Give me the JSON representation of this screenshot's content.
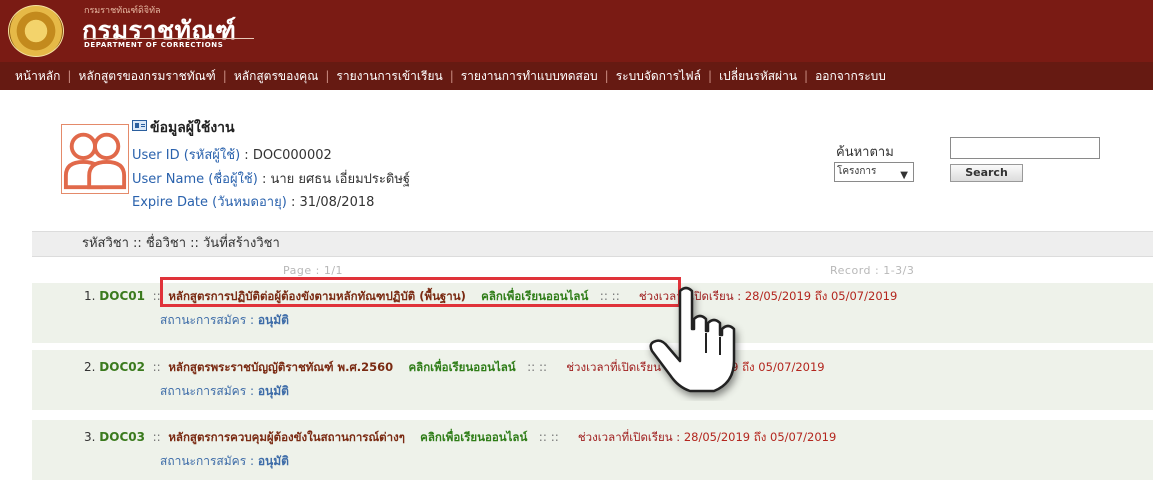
{
  "header": {
    "org_subtitle": "กรมราชทัณฑ์ดิจิทัล",
    "org_title": "กรมราชทัณฑ์",
    "org_english": "DEPARTMENT OF CORRECTIONS"
  },
  "nav": {
    "items": [
      "หน้าหลัก",
      "หลักสูตรของกรมราชทัณฑ์",
      "หลักสูตรของคุณ",
      "รายงานการเข้าเรียน",
      "รายงานการทำแบบทดสอบ",
      "ระบบจัดการไฟล์",
      "เปลี่ยนรหัสผ่าน",
      "ออกจากระบบ"
    ]
  },
  "user": {
    "title": "ข้อมูลผู้ใช้งาน",
    "id_label": "User ID (รหัสผู้ใช้)",
    "id_value": " : DOC000002",
    "name_label": "User Name (ชื่อผู้ใช้)",
    "name_value": " : นาย ยศธน  เอี่ยมประดิษฐ์",
    "expire_label": "Expire Date (วันหมดอายุ)",
    "expire_value": " : 31/08/2018"
  },
  "search": {
    "label": "ค้นหาตาม",
    "input_value": "",
    "select_value": "โครงการ",
    "button": "Search"
  },
  "course_list": {
    "header": "รหัสวิชา :: ชื่อวิชา :: วันที่สร้างวิชา",
    "page": "Page : 1/1",
    "record": "Record : 1-3/3",
    "items": [
      {
        "num": "1.",
        "code": "DOC01",
        "name": "หลักสูตรการปฏิบัติต่อผู้ต้องขังตามหลักทัณฑปฏิบัติ (พื้นฐาน)",
        "learn": "คลิกเพื่อเรียนออนไลน์",
        "period_label": "ช่วงเวลาที่เปิดเรียน :",
        "period": "28/05/2019 ถึง 05/07/2019",
        "status_label": "สถานะการสมัคร :",
        "status": "อนุมัติ"
      },
      {
        "num": "2.",
        "code": "DOC02",
        "name": "หลักสูตรพระราชบัญญัติราชทัณฑ์ พ.ศ.2560",
        "learn": "คลิกเพื่อเรียนออนไลน์",
        "period_label": "ช่วงเวลาที่เปิดเรียน :",
        "period": "28/05/2019 ถึง 05/07/2019",
        "status_label": "สถานะการสมัคร :",
        "status": "อนุมัติ"
      },
      {
        "num": "3.",
        "code": "DOC03",
        "name": "หลักสูตรการควบคุมผู้ต้องขังในสถานการณ์ต่างๆ",
        "learn": "คลิกเพื่อเรียนออนไลน์",
        "period_label": "ช่วงเวลาที่เปิดเรียน :",
        "period": "28/05/2019 ถึง 05/07/2019",
        "status_label": "สถานะการสมัคร :",
        "status": "อนุมัติ"
      }
    ]
  },
  "icons": {
    "seal": "department-seal-icon",
    "avatar": "users-icon",
    "card": "id-card-icon",
    "pointer": "hand-pointer-icon"
  },
  "colors": {
    "banner": "#7a1b14",
    "nav": "#661a12",
    "highlight": "#e0333a",
    "code_green": "#3a7a1d",
    "course_name": "#7a2a12"
  }
}
